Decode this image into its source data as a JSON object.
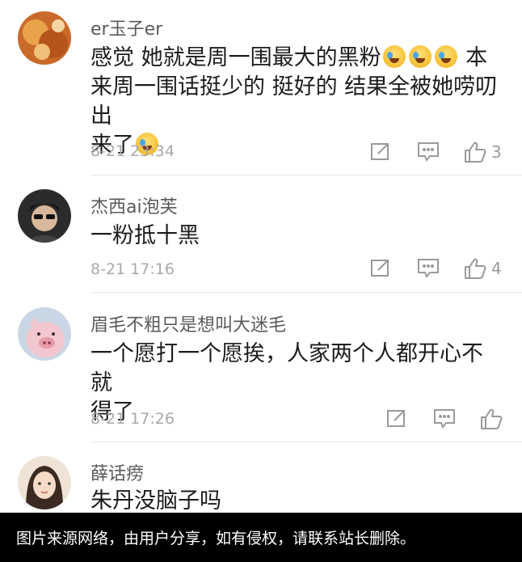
{
  "comments": [
    {
      "username": "er玉子er",
      "text_lines": [
        "感觉 她就是周一围最大的黑粉",
        "来周一围话挺少的 挺好的 结果全被她唠叨出",
        "来了"
      ],
      "inline_tail": "本",
      "emoji_name": "laugh-cry-emoji",
      "time": "8-21 23:34",
      "likes": "3"
    },
    {
      "username": "杰西ai泡芙",
      "text": "一粉抵十黑",
      "time": "8-21 17:16",
      "likes": "4"
    },
    {
      "username": "眉毛不粗只是想叫大迷毛",
      "text_lines": [
        "一个愿打一个愿挨，人家两个人都开心不就",
        "得了"
      ],
      "time": "8-21 17:26",
      "likes": ""
    },
    {
      "username": "薛话痨",
      "text": "朱丹没脑子吗"
    }
  ],
  "icons": {
    "share": "share-icon",
    "comment": "comment-icon",
    "like": "like-icon"
  },
  "banner": {
    "text": "图片来源网络，由用户分享，如有侵权，请联系站长删除。"
  }
}
